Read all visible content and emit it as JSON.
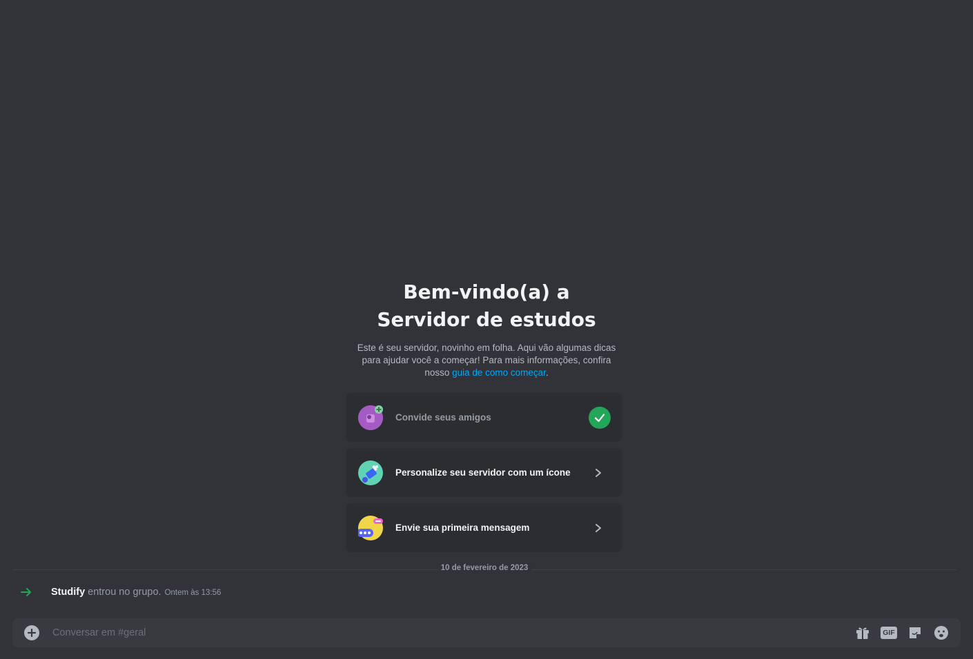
{
  "welcome": {
    "title_line1": "Bem-vindo(a) a",
    "title_line2": "Servidor de estudos",
    "description": "Este é seu servidor, novinho em folha. Aqui vão algumas dicas para ajudar você a começar! Para mais informações, confira nosso ",
    "link_text": "guia de como começar",
    "description_end": "."
  },
  "checklist": [
    {
      "label": "Convide seus amigos",
      "icon": "invite-friends-icon",
      "state": "done"
    },
    {
      "label": "Personalize seu servidor com um ícone",
      "icon": "customize-icon",
      "state": "todo"
    },
    {
      "label": "Envie sua primeira mensagem",
      "icon": "first-message-icon",
      "state": "todo"
    }
  ],
  "divider": {
    "date": "10 de fevereiro de 2023"
  },
  "system_message": {
    "user": "Studify",
    "text": "entrou no grupo.",
    "timestamp": "Ontem às 13:56"
  },
  "composer": {
    "placeholder": "Conversar em #geral",
    "gif_label": "GIF"
  },
  "colors": {
    "background": "#313338",
    "card": "#2b2d31",
    "link": "#00a8fc",
    "success": "#23a55a",
    "join_arrow": "#23a55a"
  }
}
